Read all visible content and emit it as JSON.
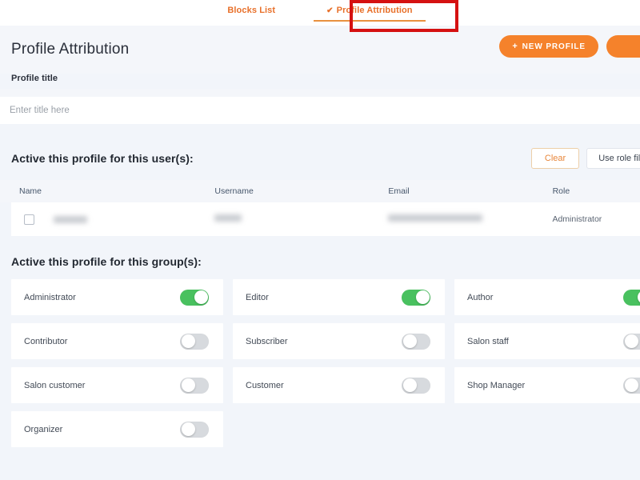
{
  "tabs": [
    {
      "label": "Blocks List",
      "active": false,
      "check": ""
    },
    {
      "label": "Profile Attribution",
      "active": true,
      "check": "✔"
    }
  ],
  "header": {
    "title": "Profile Attribution",
    "new_profile_label": "+ NEW PROFILE",
    "new_profile_plus": "+",
    "new_profile_text": "NEW PROFILE",
    "secondary_button_label": ""
  },
  "profile_title": {
    "label": "Profile title",
    "placeholder": "Enter title here",
    "value": ""
  },
  "users_section": {
    "heading": "Active this profile for this user(s):",
    "clear_label": "Clear",
    "role_filter_label": "Use role filter",
    "columns": [
      "Name",
      "Username",
      "Email",
      "Role"
    ],
    "rows": [
      {
        "name": "",
        "username": "",
        "email": "",
        "role": "Administrator",
        "checked": false
      }
    ]
  },
  "groups_section": {
    "heading": "Active this profile for this group(s):",
    "groups": [
      {
        "label": "Administrator",
        "enabled": true
      },
      {
        "label": "Editor",
        "enabled": true
      },
      {
        "label": "Author",
        "enabled": true
      },
      {
        "label": "Contributor",
        "enabled": false
      },
      {
        "label": "Subscriber",
        "enabled": false
      },
      {
        "label": "Salon staff",
        "enabled": false
      },
      {
        "label": "Salon customer",
        "enabled": false
      },
      {
        "label": "Customer",
        "enabled": false
      },
      {
        "label": "Shop Manager",
        "enabled": false
      },
      {
        "label": "Organizer",
        "enabled": false
      }
    ]
  },
  "annotation": {
    "highlight_color": "#d51111"
  },
  "colors": {
    "accent_orange": "#f5822b",
    "tab_orange": "#e8702a",
    "toggle_on": "#49c15f",
    "toggle_off": "#d7dade",
    "page_bg": "#f2f5fa"
  }
}
